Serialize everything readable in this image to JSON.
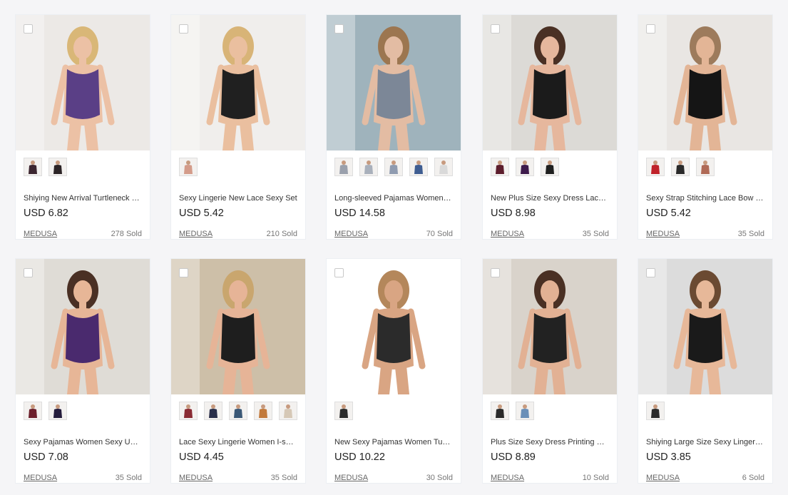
{
  "products": [
    {
      "title": "Shiying New Arrival Turtleneck Lace Teddy",
      "price": "USD 6.82",
      "shop": "MEDUSA",
      "sold": "278 Sold",
      "bg": "#ece9e6",
      "garment": "#5a3f86",
      "skin": "#ecc1a5",
      "hair": "#d9b777",
      "thumbs": [
        "#3c2630",
        "#2c2426"
      ]
    },
    {
      "title": "Sexy Lingerie New Lace Sexy Set",
      "price": "USD 5.42",
      "shop": "MEDUSA",
      "sold": "210 Sold",
      "bg": "#f0eeec",
      "garment": "#202020",
      "skin": "#eabf9f",
      "hair": "#d8b477",
      "thumbs": [
        "#d49c8a"
      ]
    },
    {
      "title": "Long-sleeved Pajamas Women Set",
      "price": "USD 14.58",
      "shop": "MEDUSA",
      "sold": "70 Sold",
      "bg": "#9fb3bc",
      "garment": "#7c8797",
      "skin": "#e3bca3",
      "hair": "#9c7650",
      "thumbs": [
        "#9aa0ac",
        "#a9b0bb",
        "#8f9bb0",
        "#3f5d91",
        "#d9d9d9"
      ]
    },
    {
      "title": "New Plus Size Sexy Dress Lace Sleepwear",
      "price": "USD 8.98",
      "shop": "MEDUSA",
      "sold": "35 Sold",
      "bg": "#dcdad6",
      "garment": "#1b1b1b",
      "skin": "#e6b79d",
      "hair": "#4a3024",
      "thumbs": [
        "#5c1d2c",
        "#3e1b4c",
        "#1f1f1f"
      ]
    },
    {
      "title": "Sexy Strap Stitching Lace Bow Design Set",
      "price": "USD 5.42",
      "shop": "MEDUSA",
      "sold": "35 Sold",
      "bg": "#e9e6e3",
      "garment": "#151515",
      "skin": "#e3b596",
      "hair": "#9d7b5c",
      "thumbs": [
        "#c0222a",
        "#2a2a2a",
        "#b06a56"
      ]
    },
    {
      "title": "Sexy Pajamas Women Sexy Underwear",
      "price": "USD 7.08",
      "shop": "MEDUSA",
      "sold": "35 Sold",
      "bg": "#dfdcd6",
      "garment": "#4a2a6e",
      "skin": "#e7b697",
      "hair": "#4a3024",
      "thumbs": [
        "#6c1f2b",
        "#241c3c"
      ]
    },
    {
      "title": "Lace Sexy Lingerie Women I-shaped Top",
      "price": "USD 4.45",
      "shop": "MEDUSA",
      "sold": "35 Sold",
      "bg": "#cdbfa8",
      "garment": "#1e1e1e",
      "skin": "#e6b497",
      "hair": "#c9a66e",
      "thumbs": [
        "#8a2b33",
        "#2a2f4a",
        "#3b5876",
        "#c27a3c",
        "#d6c8b6"
      ]
    },
    {
      "title": "New Sexy Pajamas Women Turtleneck Bodysuit",
      "price": "USD 10.22",
      "shop": "MEDUSA",
      "sold": "30 Sold",
      "bg": "#ffffff",
      "garment": "#2b2b2b",
      "skin": "#d9a583",
      "hair": "#b4875b",
      "thumbs": [
        "#2b2b2b"
      ]
    },
    {
      "title": "Plus Size Sexy Dress Printing Cotton Nightgown",
      "price": "USD 8.89",
      "shop": "MEDUSA",
      "sold": "10 Sold",
      "bg": "#d9d3cb",
      "garment": "#222222",
      "skin": "#e2b194",
      "hair": "#4a3024",
      "thumbs": [
        "#2a2a2a",
        "#6a8fb8"
      ]
    },
    {
      "title": "Shiying Large Size Sexy Lingerie Set",
      "price": "USD 3.85",
      "shop": "MEDUSA",
      "sold": "6 Sold",
      "bg": "#dcdcdc",
      "garment": "#1a1a1a",
      "skin": "#e7b899",
      "hair": "#6b4a32",
      "thumbs": [
        "#2b2b2b"
      ]
    }
  ]
}
